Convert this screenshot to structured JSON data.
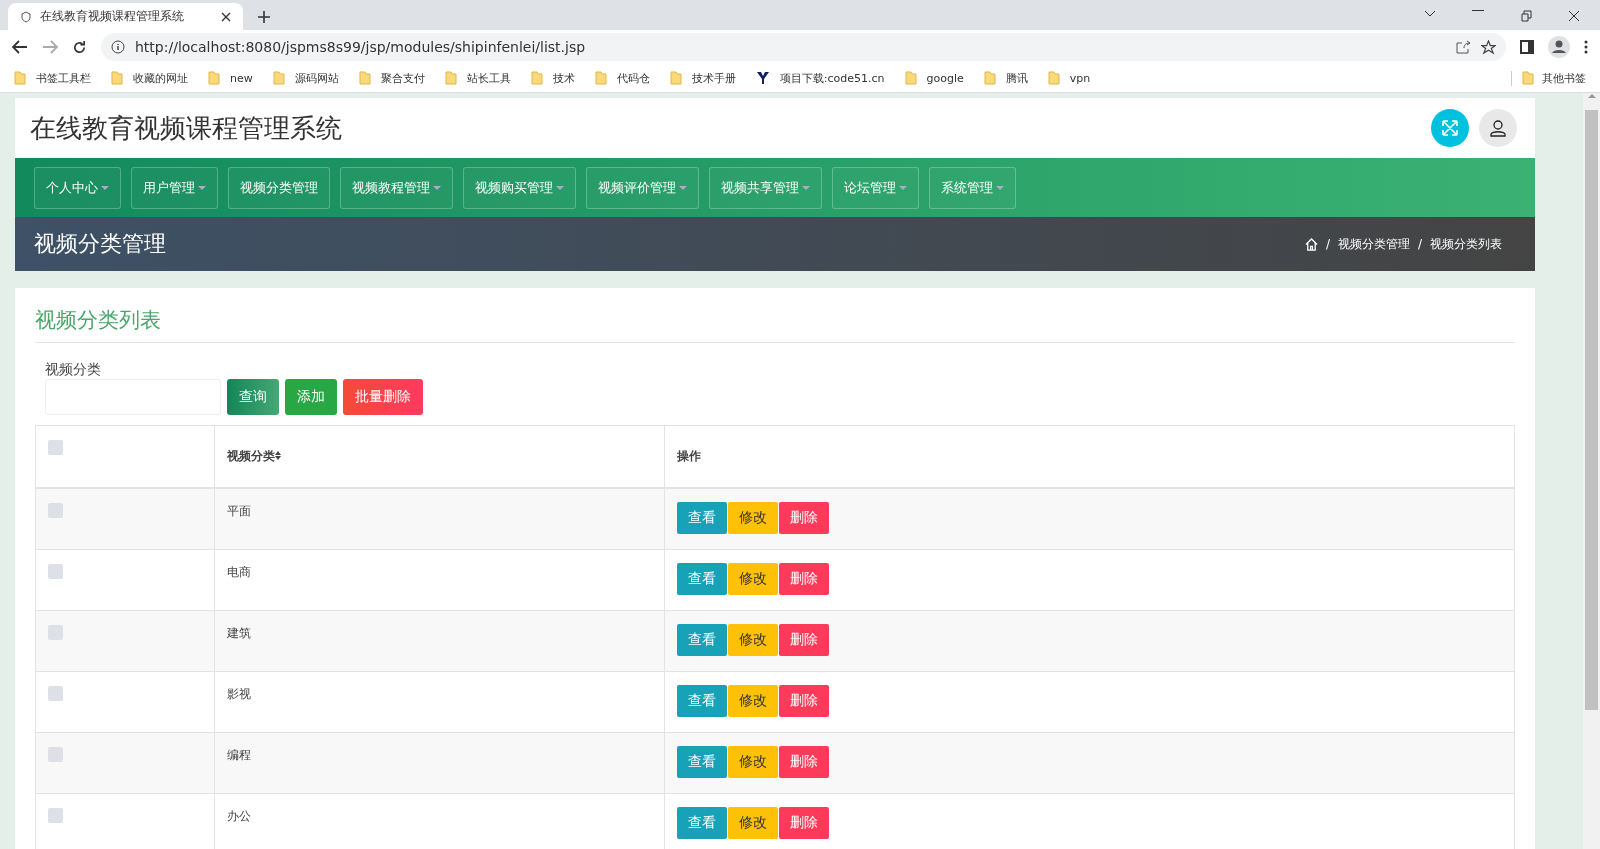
{
  "browser": {
    "tab_title": "在线教育视频课程管理系统",
    "url": "http://localhost:8080/jspms8s99/jsp/modules/shipinfenlei/list.jsp",
    "bookmarks": [
      {
        "label": "书签工具栏",
        "kind": "folder"
      },
      {
        "label": "收藏的网址",
        "kind": "folder"
      },
      {
        "label": "new",
        "kind": "folder"
      },
      {
        "label": "源码网站",
        "kind": "folder"
      },
      {
        "label": "聚合支付",
        "kind": "folder"
      },
      {
        "label": "站长工具",
        "kind": "folder"
      },
      {
        "label": "技术",
        "kind": "folder"
      },
      {
        "label": "代码仓",
        "kind": "folder"
      },
      {
        "label": "技术手册",
        "kind": "folder"
      },
      {
        "label": "项目下载:code51.cn",
        "kind": "site"
      },
      {
        "label": "google",
        "kind": "folder"
      },
      {
        "label": "腾讯",
        "kind": "folder"
      },
      {
        "label": "vpn",
        "kind": "folder"
      }
    ],
    "other_bookmarks": "其他书签"
  },
  "app_title": "在线教育视频课程管理系统",
  "nav": [
    {
      "label": "个人中心",
      "dropdown": true
    },
    {
      "label": "用户管理",
      "dropdown": true
    },
    {
      "label": "视频分类管理",
      "dropdown": false
    },
    {
      "label": "视频教程管理",
      "dropdown": true
    },
    {
      "label": "视频购买管理",
      "dropdown": true
    },
    {
      "label": "视频评价管理",
      "dropdown": true
    },
    {
      "label": "视频共享管理",
      "dropdown": true
    },
    {
      "label": "论坛管理",
      "dropdown": true
    },
    {
      "label": "系统管理",
      "dropdown": true
    }
  ],
  "banner": {
    "title": "视频分类管理",
    "breadcrumb": [
      {
        "separator": "/",
        "label": "视频分类管理"
      },
      {
        "separator": "/",
        "label": "视频分类列表"
      }
    ]
  },
  "card_title": "视频分类列表",
  "search": {
    "label": "视频分类",
    "buttons": [
      {
        "label": "查询",
        "kind": "search"
      },
      {
        "label": "添加",
        "kind": "add"
      },
      {
        "label": "批量删除",
        "kind": "delete"
      }
    ]
  },
  "table": {
    "select_all_checked": false,
    "columns": [
      "视频分类",
      "操作"
    ],
    "rows": [
      {
        "name": "平面",
        "checked": false,
        "actions": [
          {
            "label": "查看",
            "kind": "view"
          },
          {
            "label": "修改",
            "kind": "edit"
          },
          {
            "label": "删除",
            "kind": "delete"
          }
        ]
      },
      {
        "name": "电商",
        "checked": false,
        "actions": [
          {
            "label": "查看",
            "kind": "view"
          },
          {
            "label": "修改",
            "kind": "edit"
          },
          {
            "label": "删除",
            "kind": "delete"
          }
        ]
      },
      {
        "name": "建筑",
        "checked": false,
        "actions": [
          {
            "label": "查看",
            "kind": "view"
          },
          {
            "label": "修改",
            "kind": "edit"
          },
          {
            "label": "删除",
            "kind": "delete"
          }
        ]
      },
      {
        "name": "影视",
        "checked": false,
        "actions": [
          {
            "label": "查看",
            "kind": "view"
          },
          {
            "label": "修改",
            "kind": "edit"
          },
          {
            "label": "删除",
            "kind": "delete"
          }
        ]
      },
      {
        "name": "编程",
        "checked": false,
        "actions": [
          {
            "label": "查看",
            "kind": "view"
          },
          {
            "label": "修改",
            "kind": "edit"
          },
          {
            "label": "删除",
            "kind": "delete"
          }
        ]
      },
      {
        "name": "办公",
        "checked": false,
        "actions": [
          {
            "label": "查看",
            "kind": "view"
          },
          {
            "label": "修改",
            "kind": "edit"
          },
          {
            "label": "删除",
            "kind": "delete"
          }
        ]
      }
    ]
  }
}
